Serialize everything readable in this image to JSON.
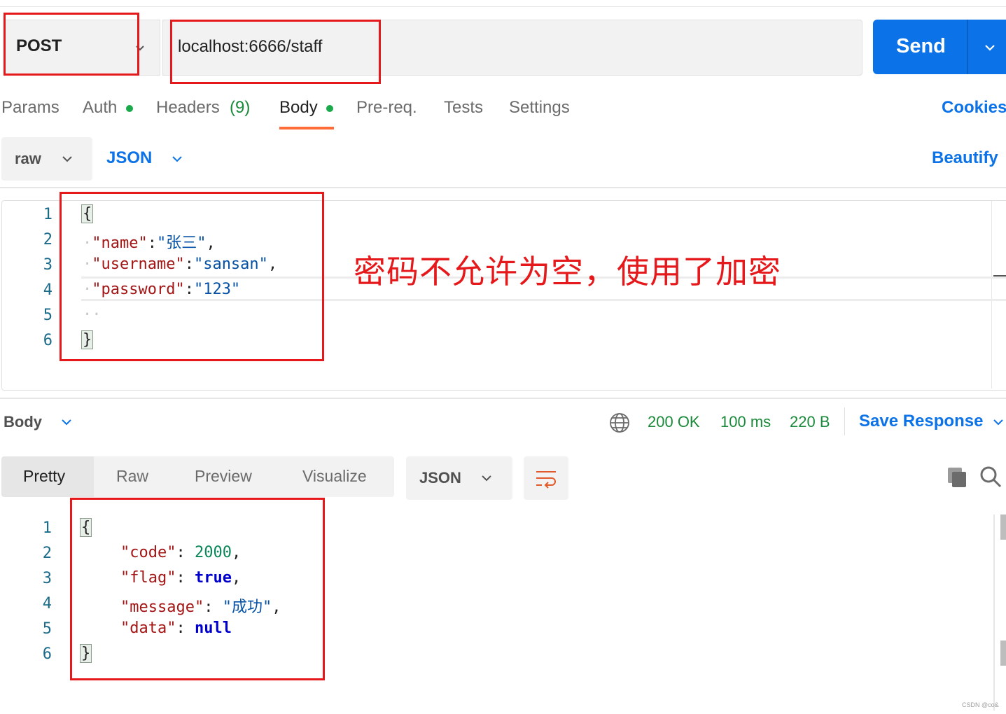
{
  "request": {
    "method": "POST",
    "url": "localhost:6666/staff",
    "send_label": "Send"
  },
  "request_tabs": [
    {
      "label": "Params"
    },
    {
      "label": "Auth"
    },
    {
      "label": "Headers",
      "count": "(9)"
    },
    {
      "label": "Body"
    },
    {
      "label": "Pre-req."
    },
    {
      "label": "Tests"
    },
    {
      "label": "Settings"
    }
  ],
  "cookies_label": "Cookies",
  "body_toolbar": {
    "mode": "raw",
    "format": "JSON",
    "beautify_label": "Beautify"
  },
  "request_body": {
    "line_numbers": [
      "1",
      "2",
      "3",
      "4",
      "5",
      "6"
    ],
    "lines": {
      "open": "{",
      "name_key": "\"name\"",
      "name_val": "\"张三\"",
      "username_key": "\"username\"",
      "username_val": "\"sansan\"",
      "password_key": "\"password\"",
      "password_val": "\"123\"",
      "close": "}"
    }
  },
  "annotation": "密码不允许为空，使用了加密",
  "response": {
    "section_label": "Body",
    "status": "200 OK",
    "time": "100 ms",
    "size": "220 B",
    "save_label": "Save Response",
    "view_tabs": [
      "Pretty",
      "Raw",
      "Preview",
      "Visualize"
    ],
    "format": "JSON",
    "line_numbers": [
      "1",
      "2",
      "3",
      "4",
      "5",
      "6"
    ],
    "lines": {
      "open": "{",
      "code_key": "\"code\"",
      "code_val": "2000",
      "flag_key": "\"flag\"",
      "flag_val": "true",
      "message_key": "\"message\"",
      "message_val": "\"成功\"",
      "data_key": "\"data\"",
      "data_val": "null",
      "close": "}"
    }
  },
  "colors": {
    "accent": "#0c72e8",
    "active_tab": "#ff6c37",
    "dot": "#1aa94a",
    "status": "#1a8a3a",
    "annotation": "#e5191b"
  },
  "watermark": "CSDN @co&"
}
